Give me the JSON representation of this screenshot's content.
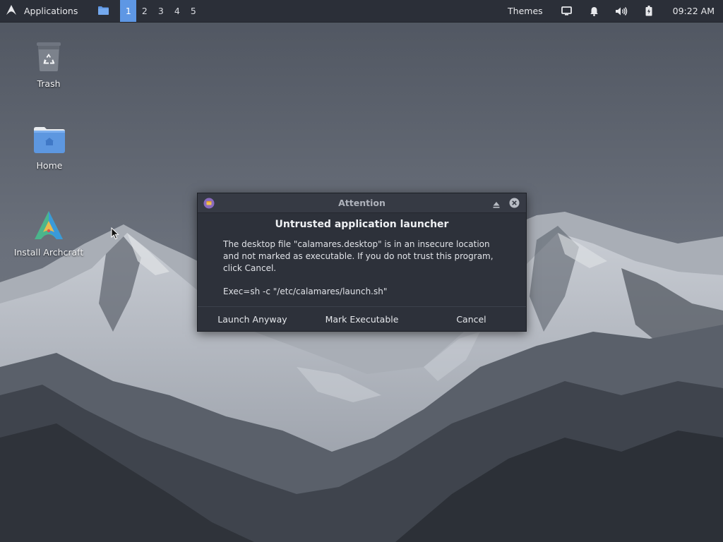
{
  "panel": {
    "applications_label": "Applications",
    "workspaces": [
      "1",
      "2",
      "3",
      "4",
      "5"
    ],
    "active_workspace": "1",
    "themes_label": "Themes",
    "clock": "09:22 AM",
    "tray_icons": [
      "display-icon",
      "bell-icon",
      "volume-icon",
      "battery-icon"
    ]
  },
  "desktop": {
    "icons": [
      {
        "label": "Trash",
        "icon": "trash-icon"
      },
      {
        "label": "Home",
        "icon": "home-folder-icon"
      },
      {
        "label": "Install Archcraft",
        "icon": "archcraft-installer-icon"
      }
    ]
  },
  "dialog": {
    "title": "Attention",
    "heading": "Untrusted application launcher",
    "message": "The desktop file \"calamares.desktop\" is in an insecure location and not marked as executable. If you do not trust this program, click Cancel.",
    "exec": "Exec=sh -c \"/etc/calamares/launch.sh\"",
    "buttons": {
      "launch": "Launch Anyway",
      "mark": "Mark Executable",
      "cancel": "Cancel"
    }
  },
  "colors": {
    "panel_bg": "#2b2f38",
    "accent": "#5e97e4",
    "dialog_bg": "#2d313a",
    "titlebar_bg": "#363a44"
  }
}
